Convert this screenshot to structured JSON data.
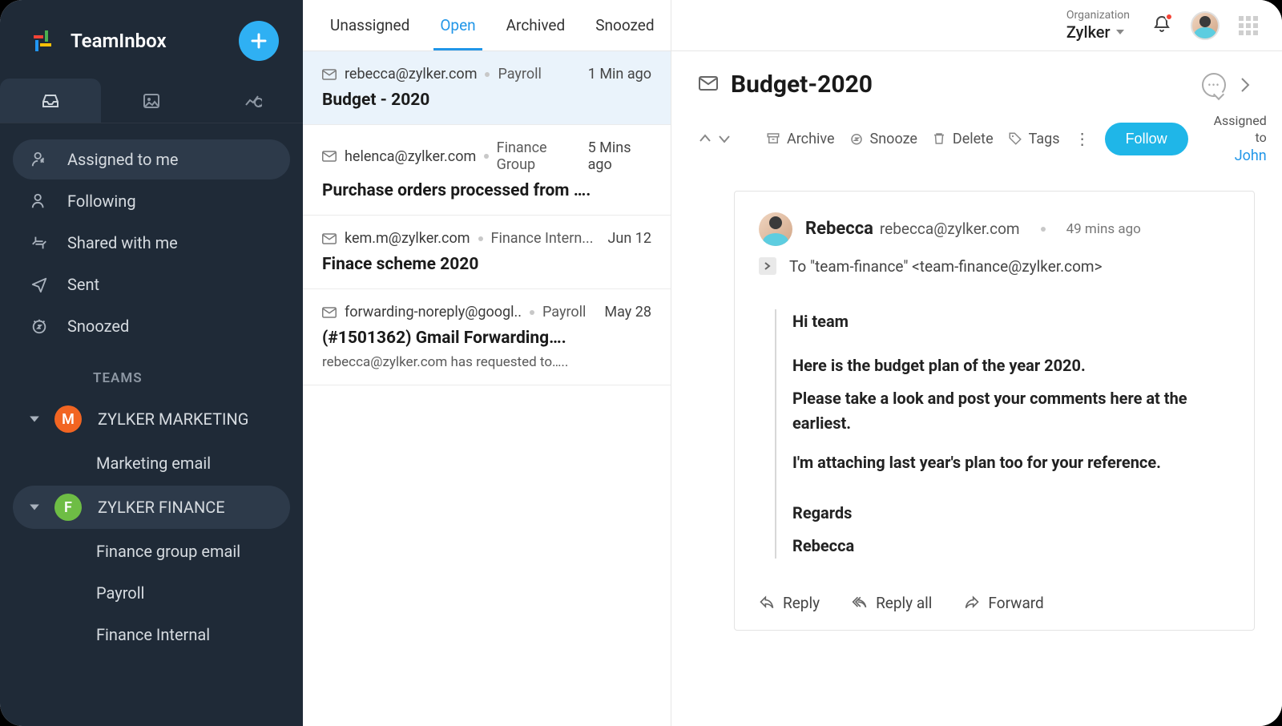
{
  "app": {
    "title": "TeamInbox"
  },
  "sidebar": {
    "nav": [
      {
        "label": "Assigned to me"
      },
      {
        "label": "Following"
      },
      {
        "label": "Shared with me"
      },
      {
        "label": "Sent"
      },
      {
        "label": "Snoozed"
      }
    ],
    "teams_header": "TEAMS",
    "teams": [
      {
        "initial": "M",
        "label": "ZYLKER MARKETING",
        "color": "#f26522",
        "channels": [
          {
            "label": "Marketing email"
          }
        ]
      },
      {
        "initial": "F",
        "label": "ZYLKER FINANCE",
        "color": "#6ebd45",
        "channels": [
          {
            "label": "Finance group email"
          },
          {
            "label": "Payroll"
          },
          {
            "label": "Finance Internal"
          }
        ]
      }
    ]
  },
  "list": {
    "tabs": [
      "Unassigned",
      "Open",
      "Archived",
      "Snoozed"
    ],
    "threads": [
      {
        "from": "rebecca@zylker.com",
        "tag": "Payroll",
        "time": "1 Min ago",
        "subject": "Budget - 2020"
      },
      {
        "from": "helenca@zylker.com",
        "tag": "Finance Group",
        "time": "5 Mins ago",
        "subject": "Purchase orders processed from …."
      },
      {
        "from": "kem.m@zylker.com",
        "tag": "Finance Intern...",
        "time": "Jun 12",
        "subject": "Finace scheme 2020"
      },
      {
        "from": "forwarding-noreply@googl..",
        "tag": "Payroll",
        "time": "May 28",
        "subject": "(#1501362) Gmail Forwarding….",
        "snippet": "rebecca@zylker.com has requested to….."
      }
    ]
  },
  "header": {
    "org_label": "Organization",
    "org_name": "Zylker"
  },
  "detail": {
    "subject": "Budget-2020",
    "actions": {
      "archive": "Archive",
      "snooze": "Snooze",
      "delete": "Delete",
      "tags": "Tags"
    },
    "follow": "Follow",
    "assigned_label": "Assigned to",
    "assigned_name": "John",
    "message": {
      "from_name": "Rebecca",
      "from_email": "rebecca@zylker.com",
      "time": "49 mins ago",
      "to": "To \"team-finance\" <team-finance@zylker.com>",
      "greeting": "Hi team",
      "p1": "Here is the budget plan of the year 2020.",
      "p2": "Please take a look and post your comments here at the earliest.",
      "p3": "I'm attaching last year's plan too for your reference.",
      "sig1": "Regards",
      "sig2": "Rebecca"
    },
    "reply_actions": {
      "reply": "Reply",
      "reply_all": "Reply all",
      "forward": "Forward"
    }
  }
}
